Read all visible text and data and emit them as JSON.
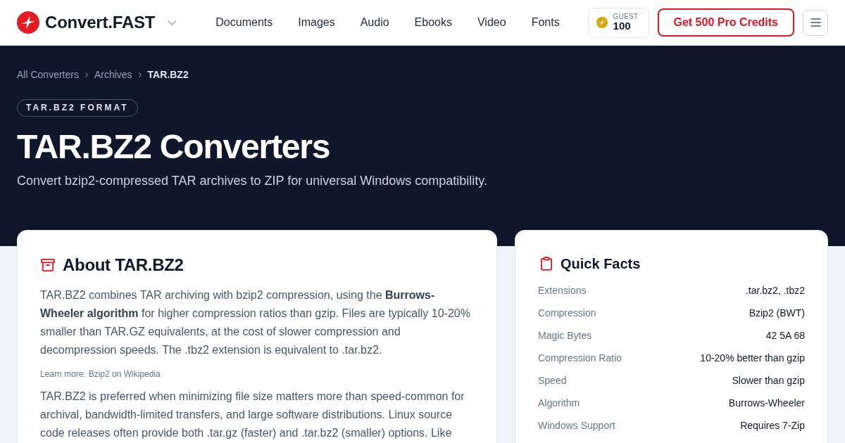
{
  "header": {
    "brand": "Convert.FAST",
    "nav": [
      {
        "label": "Documents"
      },
      {
        "label": "Images"
      },
      {
        "label": "Audio"
      },
      {
        "label": "Ebooks"
      },
      {
        "label": "Video"
      },
      {
        "label": "Fonts"
      }
    ],
    "credits": {
      "label": "GUEST",
      "value": "100"
    },
    "cta": "Get 500 Pro Credits"
  },
  "hero": {
    "breadcrumbs": [
      {
        "label": "All Converters",
        "current": false
      },
      {
        "label": "Archives",
        "current": false
      },
      {
        "label": "TAR.BZ2",
        "current": true
      }
    ],
    "badge": "TAR.BZ2 FORMAT",
    "title": "TAR.BZ2 Converters",
    "subtitle": "Convert bzip2-compressed TAR archives to ZIP for universal Windows compatibility."
  },
  "about": {
    "title": "About TAR.BZ2",
    "intro": "TAR.BZ2 combines TAR archiving with bzip2 compression, using the **Burrows-Wheeler algorithm** for higher compression ratios than gzip. Files are typically 10-20% smaller than TAR.GZ equivalents, at the cost of slower compression and decompression speeds. The .tbz2 extension is equivalent to .tar.bz2.",
    "learn_more": {
      "label": "Learn more:",
      "link": "Bzip2 on Wikipedia"
    },
    "body": "TAR.BZ2 is preferred when minimizing file size matters more than speed-common for archival, bandwidth-limited transfers, and large software distributions. Linux source code releases often provide both .tar.gz (faster) and .tar.bz2 (smaller) options. Like"
  },
  "quick_facts": {
    "title": "Quick Facts",
    "rows": [
      {
        "label": "Extensions",
        "value": ".tar.bz2, .tbz2"
      },
      {
        "label": "Compression",
        "value": "Bzip2 (BWT)"
      },
      {
        "label": "Magic Bytes",
        "value": "42 5A 68"
      },
      {
        "label": "Compression Ratio",
        "value": "10-20% better than gzip"
      },
      {
        "label": "Speed",
        "value": "Slower than gzip"
      },
      {
        "label": "Algorithm",
        "value": "Burrows-Wheeler"
      },
      {
        "label": "Windows Support",
        "value": "Requires 7-Zip"
      }
    ]
  }
}
